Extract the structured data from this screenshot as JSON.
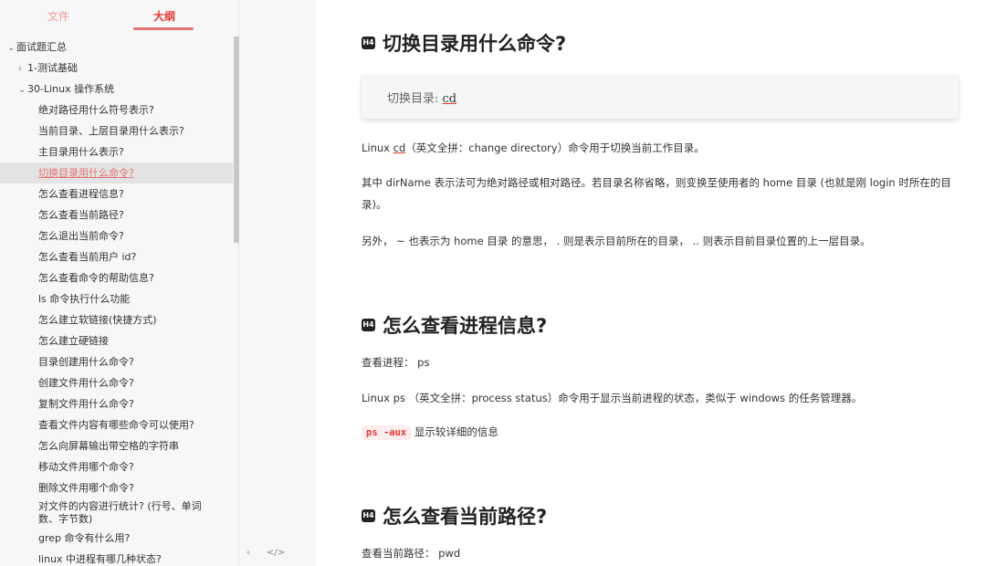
{
  "sidebar": {
    "tabs": {
      "files": "文件",
      "outline": "大纲"
    },
    "items": [
      {
        "label": "面试题汇总",
        "caret": "⌄",
        "level": 0
      },
      {
        "label": "1-测试基础",
        "caret": "›",
        "level": 1
      },
      {
        "label": "30-Linux 操作系统",
        "caret": "⌄",
        "level": 1
      },
      {
        "label": "绝对路径用什么符号表示?",
        "level": 2
      },
      {
        "label": "当前目录、上层目录用什么表示?",
        "level": 2
      },
      {
        "label": "主目录用什么表示?",
        "level": 2
      },
      {
        "label": "切换目录用什么命令?",
        "level": 2,
        "active": true
      },
      {
        "label": "怎么查看进程信息?",
        "level": 2
      },
      {
        "label": "怎么查看当前路径?",
        "level": 2
      },
      {
        "label": "怎么退出当前命令?",
        "level": 2
      },
      {
        "label": "怎么查看当前用户 id?",
        "level": 2
      },
      {
        "label": "怎么查看命令的帮助信息?",
        "level": 2
      },
      {
        "label": "ls 命令执行什么功能",
        "level": 2
      },
      {
        "label": "怎么建立软链接(快捷方式)",
        "level": 2
      },
      {
        "label": "怎么建立硬链接",
        "level": 2
      },
      {
        "label": "目录创建用什么命令?",
        "level": 2
      },
      {
        "label": "创建文件用什么命令?",
        "level": 2
      },
      {
        "label": "复制文件用什么命令?",
        "level": 2
      },
      {
        "label": "查看文件内容有哪些命令可以使用?",
        "level": 2
      },
      {
        "label": "怎么向屏幕输出带空格的字符串",
        "level": 2
      },
      {
        "label": "移动文件用哪个命令?",
        "level": 2
      },
      {
        "label": "删除文件用哪个命令?",
        "level": 2
      },
      {
        "label": "对文件的内容进行统计? (行号、单词数、字节数)",
        "level": 2,
        "wrap": true
      },
      {
        "label": "grep 命令有什么用?",
        "level": 2
      },
      {
        "label": "linux 中进程有哪几种状态?",
        "level": 2
      }
    ],
    "footer": {
      "collapse": "‹",
      "source": "</>"
    }
  },
  "main": {
    "badge": "H4",
    "s1": {
      "heading": "切换目录用什么命令?",
      "code_prefix": "切换目录: ",
      "code_cmd": "cd",
      "p1a": "Linux ",
      "p1_cd": "cd",
      "p1b": "（英文全拼：change directory）命令用于切换当前工作目录。",
      "p2": "其中 dirName 表示法可为绝对路径或相对路径。若目录名称省略，则变换至使用者的 home 目录 (也就是刚 login 时所在的目录)。",
      "p3": "另外，  ~  也表示为 home 目录 的意思，  .  则是表示目前所在的目录，  ..  则表示目前目录位置的上一层目录。"
    },
    "s2": {
      "heading": "怎么查看进程信息?",
      "p1": "查看进程： ps",
      "p2": "Linux ps （英文全拼：process status）命令用于显示当前进程的状态，类似于 windows 的任务管理器。",
      "code": "ps -aux",
      "p3": "显示较详细的信息"
    },
    "s3": {
      "heading": "怎么查看当前路径?",
      "p1": "查看当前路径： pwd"
    }
  }
}
